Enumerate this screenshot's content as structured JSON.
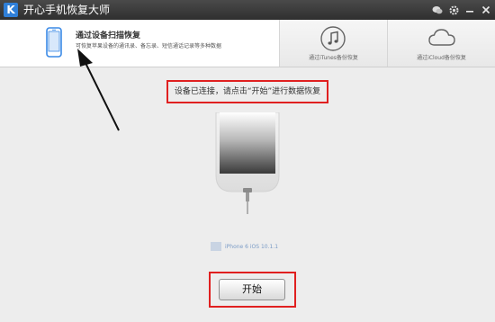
{
  "app": {
    "title": "开心手机恢复大师",
    "logo_letter": "K"
  },
  "tabs": [
    {
      "title": "通过设备扫描恢复",
      "description": "可恢复苹果设备的通讯录、备忘录、短信通话记录等多种数据",
      "icon": "phone-icon"
    },
    {
      "label": "通过iTunes备份恢复",
      "icon": "music-note-icon"
    },
    {
      "label": "通过iCloud备份恢复",
      "icon": "cloud-icon"
    }
  ],
  "main": {
    "instruction": "设备已连接，请点击“开始”进行数据恢复",
    "device_label": "iPhone 6 iOS 10.1.1",
    "start_button_label": "开始"
  },
  "colors": {
    "highlight_border": "#e02020",
    "accent": "#2f7fd8"
  }
}
